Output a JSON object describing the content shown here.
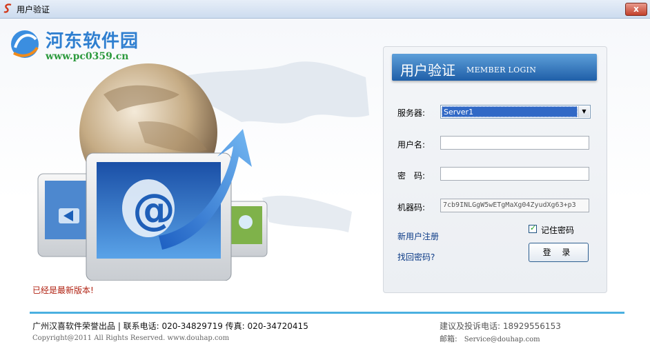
{
  "window": {
    "title": "用户验证",
    "close_glyph": "x"
  },
  "watermark": {
    "name": "河东软件园",
    "url": "www.pc0359.cn"
  },
  "version_message": "已经是最新版本!",
  "login_panel": {
    "header_title": "用户验证",
    "header_subtitle": "MEMBER LOGIN",
    "server_label": "服务器:",
    "server_value": "Server1",
    "username_label": "用户名:",
    "username_value": "",
    "password_label": "密　码:",
    "password_value": "",
    "machine_label": "机器码:",
    "machine_value": "7cb9INLGgW5wETgMaXg04ZyudXg63+p3",
    "register_link": "新用户注册",
    "recover_link": "找回密码?",
    "remember_label": "记住密码",
    "remember_checked": true,
    "login_button": "登 录"
  },
  "footer": {
    "company_line": "广州汉喜软件荣誉出品 | 联系电话: 020-34829719 传真: 020-34720415",
    "copyright": "Copyright@2011 All Rights Reserved. www.douhap.com",
    "hotline": "建议及投诉电话: 18929556153",
    "email_label": "邮箱:",
    "email_value": "Service@douhap.com"
  },
  "colors": {
    "accent": "#1f5fa8",
    "footer_bar": "#4ab0e0",
    "link": "#0b3a86",
    "warning_text": "#b02010",
    "watermark": "#2f7fd0",
    "watermark_url": "#2d9a3e"
  },
  "icons": [
    "app-logo-icon",
    "close-icon",
    "dropdown-arrow-icon",
    "checkbox-checked-icon",
    "email-at-icon",
    "globe-illustration"
  ]
}
